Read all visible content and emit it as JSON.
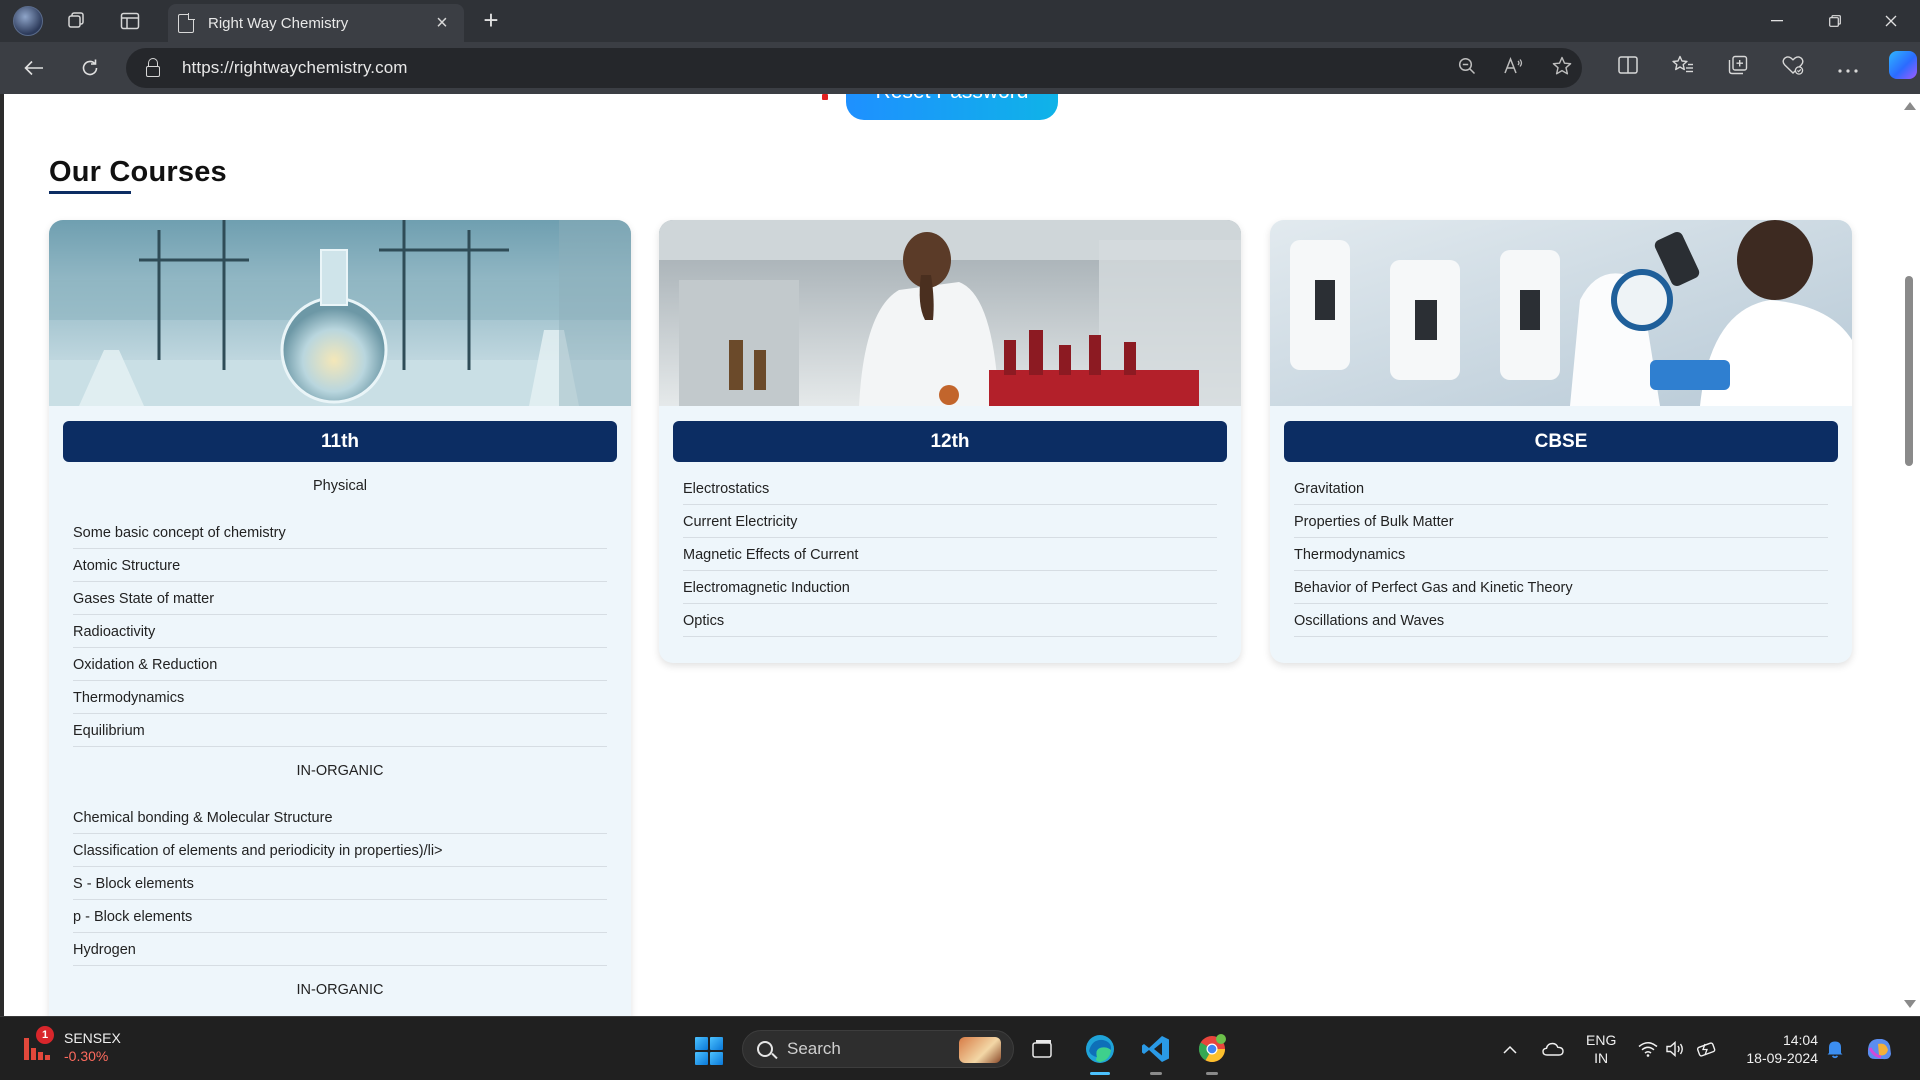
{
  "browser": {
    "tab_title": "Right Way Chemistry",
    "url": "https://rightwaychemistry.com",
    "new_tab_symbol": "+",
    "close_tab_symbol": "×"
  },
  "page": {
    "reset_button_label": "Reset Password",
    "section_title": "Our Courses",
    "courses": [
      {
        "title": "11th",
        "groups": [
          {
            "heading": "Physical",
            "items": [
              "Some basic concept of chemistry",
              "Atomic Structure",
              "Gases State of matter",
              "Radioactivity",
              "Oxidation & Reduction",
              "Thermodynamics",
              "Equilibrium"
            ]
          },
          {
            "heading": "IN-ORGANIC",
            "items": [
              "Chemical bonding & Molecular Structure",
              "Classification of elements and periodicity in properties)/li>",
              "S - Block elements",
              "p - Block elements",
              "Hydrogen"
            ]
          },
          {
            "heading": "IN-ORGANIC",
            "items": []
          }
        ]
      },
      {
        "title": "12th",
        "items": [
          "Electrostatics",
          "Current Electricity",
          "Magnetic Effects of Current",
          "Electromagnetic Induction",
          "Optics"
        ]
      },
      {
        "title": "CBSE",
        "items": [
          "Gravitation",
          "Properties of Bulk Matter",
          "Thermodynamics",
          "Behavior of Perfect Gas and Kinetic Theory",
          "Oscillations and Waves"
        ]
      }
    ]
  },
  "taskbar": {
    "widget_name": "SENSEX",
    "widget_value": "-0.30%",
    "widget_badge": "1",
    "search_placeholder": "Search",
    "lang_line1": "ENG",
    "lang_line2": "IN",
    "time": "14:04",
    "date": "18-09-2024"
  },
  "colors": {
    "accent_navy": "#0c2d63",
    "reset_button": "#1e90ff",
    "card_bg": "#eef6fb",
    "negative": "#ff6b5e"
  }
}
